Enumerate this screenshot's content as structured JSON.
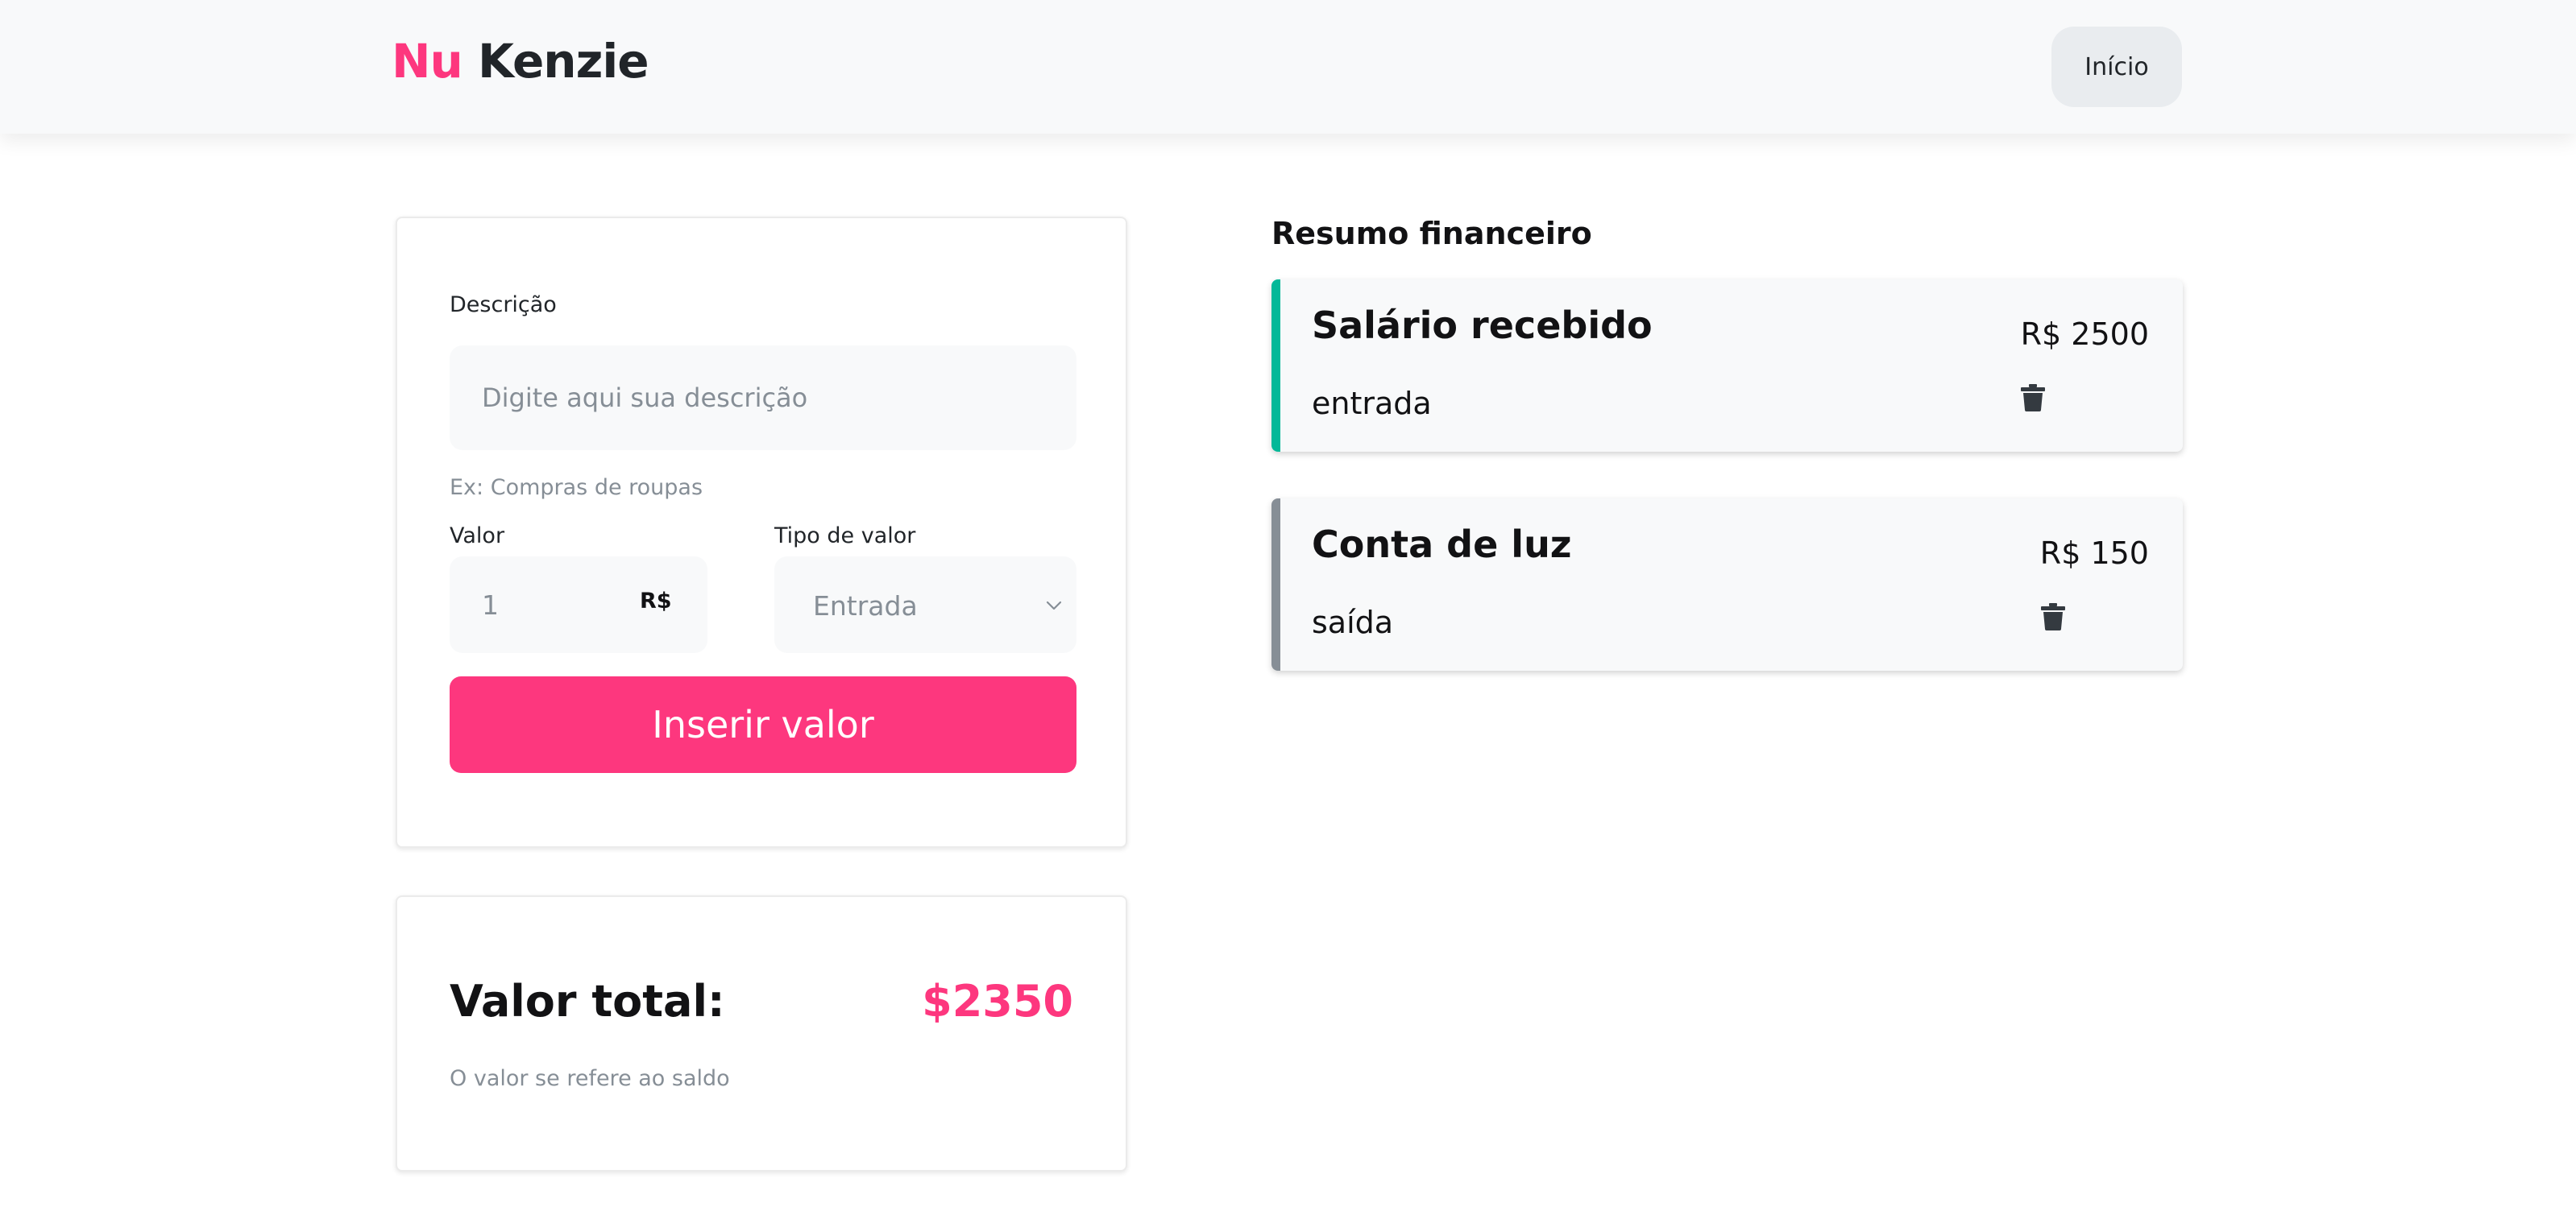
{
  "header": {
    "logo_part1": "Nu",
    "logo_part2": "Kenzie",
    "home_label": "Início"
  },
  "form": {
    "description_label": "Descrição",
    "description_placeholder": "Digite aqui sua descrição",
    "description_hint": "Ex: Compras de roupas",
    "value_label": "Valor",
    "value_value": "1",
    "currency_label": "R$",
    "type_label": "Tipo de valor",
    "type_selected": "Entrada",
    "submit_label": "Inserir valor"
  },
  "total": {
    "label": "Valor total:",
    "value": "$2350",
    "subtitle": "O valor se refere ao saldo"
  },
  "summary": {
    "title": "Resumo financeiro",
    "entries": [
      {
        "title": "Salário recebido",
        "type": "entrada",
        "amount": "R$ 2500",
        "stripe_color": "#03b898",
        "icon": "trash-icon"
      },
      {
        "title": "Conta de luz",
        "type": "saída",
        "amount": "R$ 150",
        "stripe_color": "#868e96",
        "icon": "trash-icon"
      }
    ]
  },
  "colors": {
    "brand_pink": "#fd377e",
    "dark_text": "#121214",
    "muted_text": "#868e96",
    "income_green": "#03b898",
    "expense_gray": "#868e96"
  }
}
